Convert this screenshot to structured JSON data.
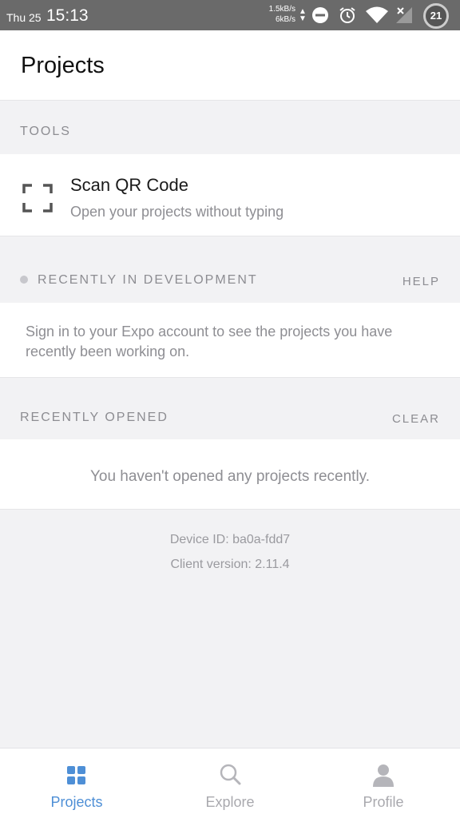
{
  "status_bar": {
    "day": "Thu 25",
    "time": "15:13",
    "net_up": "1.5kB/s",
    "net_down": "6kB/s",
    "battery": "21",
    "icons": [
      "data-arrows-icon",
      "do-not-disturb-icon",
      "alarm-icon",
      "wifi-icon",
      "no-signal-icon",
      "battery-icon"
    ]
  },
  "header": {
    "title": "Projects"
  },
  "tools": {
    "label": "TOOLS",
    "scan": {
      "title": "Scan QR Code",
      "subtitle": "Open your projects without typing",
      "icon": "qr-scan-icon"
    }
  },
  "recent_dev": {
    "label": "RECENTLY IN DEVELOPMENT",
    "action": "HELP",
    "message": "Sign in to your Expo account to see the projects you have recently been working on."
  },
  "recent_opened": {
    "label": "RECENTLY OPENED",
    "action": "CLEAR",
    "message": "You haven't opened any projects recently."
  },
  "footer": {
    "device_id": "Device ID: ba0a-fdd7",
    "client_version": "Client version: 2.11.4"
  },
  "tabs": [
    {
      "label": "Projects",
      "icon": "grid-icon",
      "active": true
    },
    {
      "label": "Explore",
      "icon": "search-icon",
      "active": false
    },
    {
      "label": "Profile",
      "icon": "person-icon",
      "active": false
    }
  ],
  "colors": {
    "accent": "#4e8fd6",
    "status_bar": "#6a6a6a",
    "background": "#f2f2f4",
    "muted_text": "#8e8e93"
  }
}
